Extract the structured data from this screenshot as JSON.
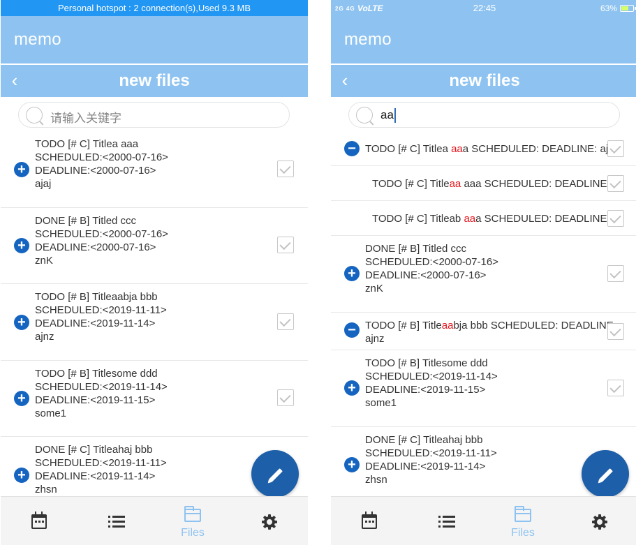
{
  "left": {
    "hotspot_text": "Personal hotspot : 2 connection(s),Used  9.3 MB",
    "app_title": "memo",
    "subtitle": "new files",
    "search_placeholder": "请输入关键字",
    "items": [
      {
        "lines": [
          "TODO [# C] Titlea aaa",
          "SCHEDULED:<2000-07-16>",
          "DEADLINE:<2000-07-16>",
          "ajaj"
        ]
      },
      {
        "lines": [
          "DONE [# B] Titled ccc",
          "SCHEDULED:<2000-07-16>",
          "DEADLINE:<2000-07-16>",
          "znK"
        ]
      },
      {
        "lines": [
          "TODO [# B] Titleaabja bbb",
          "SCHEDULED:<2019-11-11>",
          "DEADLINE:<2019-11-14>",
          "ajnz"
        ]
      },
      {
        "lines": [
          "TODO [# B] Titlesome ddd",
          "SCHEDULED:<2019-11-14>",
          "DEADLINE:<2019-11-15>",
          "some1"
        ]
      },
      {
        "lines": [
          "DONE [# C] Titleahaj bbb",
          "SCHEDULED:<2019-11-11>",
          "DEADLINE:<2019-11-14>",
          "zhsn"
        ]
      }
    ],
    "tabs": {
      "calendar_icon": "calendar-icon",
      "list_icon": "list-icon",
      "files_label": "Files",
      "settings_icon": "gear-icon"
    }
  },
  "right": {
    "status": {
      "carrier": "VoLTE",
      "signal": "2G 4G",
      "time": "22:45",
      "battery": "63%",
      "battery_level": 0.63
    },
    "app_title": "memo",
    "subtitle": "new files",
    "search_value": "aa",
    "items": [
      {
        "parts": [
          "TODO [# C] Titlea ",
          "aa",
          "a SCHEDULED: DEADLINE: aja"
        ]
      },
      {
        "parts": [
          "TODO [# C] Title",
          "aa",
          " aaa SCHEDULED: DEADLINE: j"
        ]
      },
      {
        "parts": [
          "TODO [# C] Titleab ",
          "aa",
          "a SCHEDULED: DEADLINE: j"
        ]
      },
      {
        "lines": [
          "DONE [# B] Titled ccc",
          "SCHEDULED:<2000-07-16>",
          "DEADLINE:<2000-07-16>",
          "znK"
        ]
      },
      {
        "parts": [
          "TODO [# B] Title",
          "aa",
          "bja bbb SCHEDULED: DEADLINE"
        ],
        "extra": "ajnz"
      },
      {
        "lines": [
          "TODO [# B] Titlesome ddd",
          "SCHEDULED:<2019-11-14>",
          "DEADLINE:<2019-11-15>",
          "some1"
        ]
      },
      {
        "lines": [
          "DONE [# C] Titleahaj bbb",
          "SCHEDULED:<2019-11-11>",
          "DEADLINE:<2019-11-14>",
          "zhsn"
        ]
      }
    ],
    "tabs": {
      "files_label": "Files"
    }
  },
  "colors": {
    "header": "#8ec3f1",
    "hotspot_bar": "#2196f3",
    "accent": "#1565c0",
    "fab": "#1d5fa8",
    "highlight": "#e8141b"
  }
}
